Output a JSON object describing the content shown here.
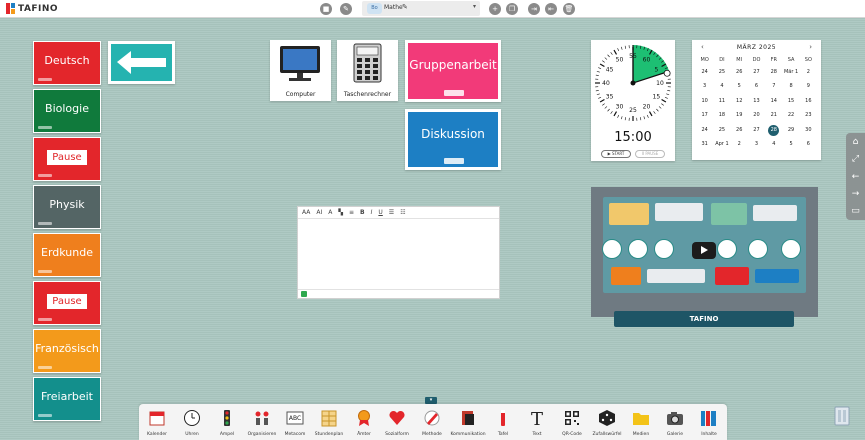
{
  "app": {
    "logo_text": "TAFINO"
  },
  "toolbar": {
    "left_icons": [
      "save-icon",
      "edit-off-icon"
    ],
    "right_icons": [
      "add-icon",
      "copy-icon",
      "import-icon",
      "export-icon",
      "delete-icon"
    ],
    "board": {
      "chip": "Bo",
      "name": "Mathe"
    }
  },
  "subjects": [
    {
      "label": "Deutsch",
      "color": "#e3262b",
      "pause": false
    },
    {
      "label": "Biologie",
      "color": "#107a3c",
      "pause": false
    },
    {
      "label": "Pause",
      "color": "#e3262b",
      "pause": true
    },
    {
      "label": "Physik",
      "color": "#546565",
      "pause": false
    },
    {
      "label": "Erdkunde",
      "color": "#ef7f1d",
      "pause": false
    },
    {
      "label": "Pause",
      "color": "#e3262b",
      "pause": true
    },
    {
      "label": "Französisch",
      "color": "#f39a1b",
      "pause": false
    },
    {
      "label": "Freiarbeit",
      "color": "#138f8c",
      "pause": false
    }
  ],
  "devices": [
    {
      "label": "Computer",
      "icon": "computer-icon"
    },
    {
      "label": "Taschenrechner",
      "icon": "calculator-icon"
    }
  ],
  "methods": [
    {
      "label": "Gruppenarbeit",
      "color": "#f23a79"
    },
    {
      "label": "Diskussion",
      "color": "#1d7fc4"
    }
  ],
  "editor": {
    "font_size": "AA",
    "font_size_alt": "AI",
    "color": "A",
    "bold": "B",
    "italic": "I",
    "underline": "U"
  },
  "clock": {
    "time": "15:00",
    "start_label": "▶ START",
    "pause_label": "II PAUSE",
    "numbers": [
      "55",
      "60",
      "5",
      "10",
      "15",
      "20",
      "25",
      "30",
      "35",
      "40",
      "45",
      "50"
    ],
    "elapsed_minutes": 12
  },
  "calendar": {
    "title": "MÄRZ 2025",
    "weekdays": [
      "MO",
      "DI",
      "MI",
      "DO",
      "FR",
      "SA",
      "SO"
    ],
    "rows": [
      [
        "24",
        "25",
        "26",
        "27",
        "28",
        "Mär 1",
        "2"
      ],
      [
        "3",
        "4",
        "5",
        "6",
        "7",
        "8",
        "9"
      ],
      [
        "10",
        "11",
        "12",
        "13",
        "14",
        "15",
        "16"
      ],
      [
        "17",
        "18",
        "19",
        "20",
        "21",
        "22",
        "23"
      ],
      [
        "24",
        "25",
        "26",
        "27",
        "28",
        "29",
        "30"
      ],
      [
        "31",
        "Apr 1",
        "2",
        "3",
        "4",
        "5",
        "6"
      ]
    ],
    "today": "28"
  },
  "video": {
    "title": "TAFINO"
  },
  "side_panel": {
    "icons": [
      "home-icon",
      "fullscreen-icon",
      "arrow-left-icon",
      "arrow-right-icon",
      "screen-icon"
    ]
  },
  "dock": [
    {
      "label": "Kalender",
      "icon": "calendar-icon"
    },
    {
      "label": "Uhren",
      "icon": "clock-icon"
    },
    {
      "label": "Ampel",
      "icon": "traffic-light-icon"
    },
    {
      "label": "Organisieren",
      "icon": "organize-icon"
    },
    {
      "label": "Metacom",
      "icon": "metacom-icon"
    },
    {
      "label": "Stundenplan",
      "icon": "timetable-icon"
    },
    {
      "label": "Ämter",
      "icon": "award-icon"
    },
    {
      "label": "Sozialform",
      "icon": "heart-icon"
    },
    {
      "label": "Methode",
      "icon": "method-icon"
    },
    {
      "label": "Kommunikation",
      "icon": "communication-icon"
    },
    {
      "label": "Tafel",
      "icon": "chalk-icon"
    },
    {
      "label": "Text",
      "icon": "text-icon"
    },
    {
      "label": "QR-Code",
      "icon": "qr-code-icon"
    },
    {
      "label": "Zufallswürfel",
      "icon": "dice-icon"
    },
    {
      "label": "Medien",
      "icon": "folder-icon"
    },
    {
      "label": "Galerie",
      "icon": "camera-icon"
    },
    {
      "label": "Inhalte",
      "icon": "binders-icon"
    }
  ]
}
